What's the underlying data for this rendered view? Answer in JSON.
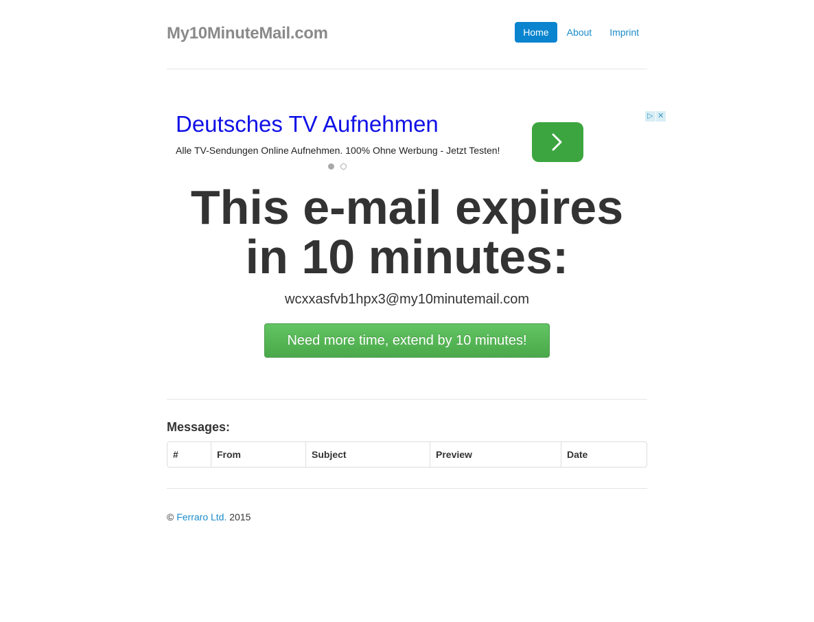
{
  "header": {
    "brand": "My10MinuteMail.com",
    "nav": [
      {
        "label": "Home",
        "active": true
      },
      {
        "label": "About",
        "active": false
      },
      {
        "label": "Imprint",
        "active": false
      }
    ]
  },
  "ad": {
    "title": "Deutsches TV Aufnehmen",
    "description": "Alle TV-Sendungen Online Aufnehmen. 100% Ohne Werbung - Jetzt Testen!",
    "arrow_icon": "chevron-right-icon",
    "choices_icons": [
      "play-triangle-icon",
      "close-icon"
    ],
    "slides": 2,
    "active_slide": 1,
    "button_color": "#3ca53f",
    "title_color": "#1010e6"
  },
  "hero": {
    "title_line1": "This e-mail expires",
    "title_line2": "in 10 minutes:",
    "email": "wcxxasfvb1hpx3@my10minutemail.com",
    "extend_button": "Need more time, extend by 10 minutes!"
  },
  "messages": {
    "heading": "Messages:",
    "columns": [
      "#",
      "From",
      "Subject",
      "Preview",
      "Date"
    ],
    "rows": []
  },
  "footer": {
    "copyright_symbol": "©",
    "company": "Ferraro Ltd.",
    "year": "2015"
  },
  "colors": {
    "accent": "#0a84cf",
    "link": "#1a8bc8",
    "success": "#5cb85c",
    "brand_gray": "#8a8a8a"
  }
}
